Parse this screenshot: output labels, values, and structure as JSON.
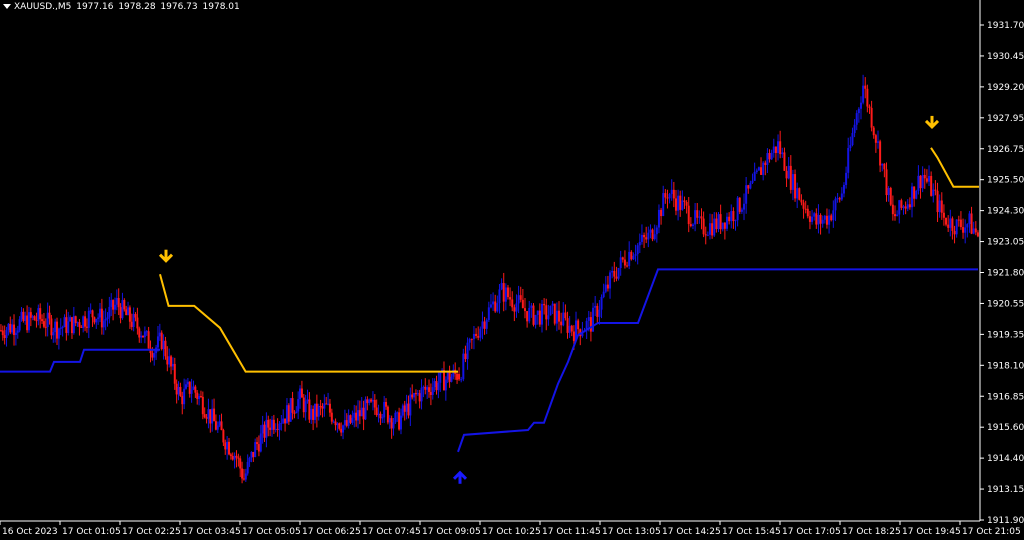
{
  "header": {
    "symbol": "XAUUSD.,M5",
    "open": "1977.16",
    "high": "1978.28",
    "low": "1976.73",
    "close": "1978.01"
  },
  "colors": {
    "background": "#000000",
    "bull_candle": "#1414e6",
    "bear_candle": "#ff1a1a",
    "upper_line": "#ffc000",
    "lower_line": "#1414e6",
    "sell_arrow": "#ffc000",
    "buy_arrow": "#1a1aff",
    "axis": "#ffffff"
  },
  "chart_data": {
    "type": "candlestick",
    "title": "",
    "ylim": [
      1911.6,
      1932.4
    ],
    "y_ticks": [
      "1931.70",
      "1930.45",
      "1929.20",
      "1927.95",
      "1926.75",
      "1925.50",
      "1924.30",
      "1923.05",
      "1921.80",
      "1920.55",
      "1919.35",
      "1918.10",
      "1916.85",
      "1915.60",
      "1914.40",
      "1913.15",
      "1911.90"
    ],
    "x_ticks": [
      "16 Oct 2023",
      "17 Oct 01:05",
      "17 Oct 02:25",
      "17 Oct 03:45",
      "17 Oct 05:05",
      "17 Oct 06:25",
      "17 Oct 07:45",
      "17 Oct 09:05",
      "17 Oct 10:25",
      "17 Oct 11:45",
      "17 Oct 13:05",
      "17 Oct 14:25",
      "17 Oct 15:45",
      "17 Oct 17:05",
      "17 Oct 18:25",
      "17 Oct 19:45",
      "17 Oct 21:05"
    ],
    "candle_count": 245,
    "anchors": [
      [
        0,
        1919.4
      ],
      [
        10,
        1919.7
      ],
      [
        20,
        1919.9
      ],
      [
        30,
        1919.5
      ],
      [
        40,
        1919.7
      ],
      [
        50,
        1920.1
      ],
      [
        55,
        1919.8
      ],
      [
        62,
        1920.5
      ],
      [
        67,
        1920.0
      ],
      [
        75,
        1919.4
      ],
      [
        78,
        1919.0
      ],
      [
        82,
        1918.6
      ],
      [
        86,
        1919.0
      ],
      [
        89,
        1918.3
      ],
      [
        92,
        1917.6
      ],
      [
        96,
        1916.6
      ],
      [
        102,
        1917.1
      ],
      [
        108,
        1916.4
      ],
      [
        114,
        1915.6
      ],
      [
        120,
        1914.9
      ],
      [
        126,
        1914.2
      ],
      [
        130,
        1913.3
      ],
      [
        136,
        1914.6
      ],
      [
        144,
        1915.6
      ],
      [
        152,
        1915.9
      ],
      [
        160,
        1916.6
      ],
      [
        166,
        1915.9
      ],
      [
        174,
        1916.2
      ],
      [
        184,
        1915.4
      ],
      [
        194,
        1916.1
      ],
      [
        202,
        1916.3
      ],
      [
        212,
        1915.6
      ],
      [
        222,
        1916.7
      ],
      [
        232,
        1917.2
      ],
      [
        244,
        1917.6
      ]
    ],
    "anchors_b": [
      [
        0,
        1917.6
      ],
      [
        8,
        1919.3
      ],
      [
        14,
        1920.2
      ],
      [
        20,
        1921.0
      ],
      [
        26,
        1920.6
      ],
      [
        34,
        1920.0
      ],
      [
        44,
        1920.1
      ],
      [
        54,
        1919.4
      ],
      [
        62,
        1919.7
      ],
      [
        72,
        1921.6
      ],
      [
        80,
        1922.6
      ],
      [
        90,
        1923.3
      ],
      [
        98,
        1925.1
      ],
      [
        106,
        1924.4
      ],
      [
        114,
        1923.6
      ],
      [
        122,
        1923.8
      ],
      [
        130,
        1924.3
      ],
      [
        138,
        1925.3
      ],
      [
        144,
        1926.4
      ],
      [
        150,
        1927.0
      ],
      [
        156,
        1925.6
      ],
      [
        162,
        1924.6
      ],
      [
        168,
        1923.8
      ],
      [
        174,
        1924.1
      ],
      [
        180,
        1925.0
      ],
      [
        186,
        1927.9
      ],
      [
        190,
        1929.5
      ],
      [
        194,
        1928.1
      ],
      [
        198,
        1926.6
      ],
      [
        204,
        1924.0
      ],
      [
        210,
        1924.6
      ],
      [
        214,
        1925.2
      ],
      [
        218,
        1925.8
      ],
      [
        222,
        1925.2
      ],
      [
        228,
        1924.0
      ],
      [
        234,
        1923.7
      ],
      [
        240,
        1923.8
      ],
      [
        244,
        1923.3
      ]
    ],
    "upper_line": [
      [
        0,
        1921.7
      ],
      [
        5,
        1920.4
      ],
      [
        20,
        1920.4
      ],
      [
        35,
        1919.5
      ],
      [
        50,
        1917.7
      ],
      [
        174,
        1917.7
      ]
    ],
    "upper_line_2": [
      [
        0,
        1926.9
      ],
      [
        4,
        1926.5
      ],
      [
        14,
        1925.3
      ],
      [
        30,
        1925.3
      ]
    ],
    "lower_line": [
      [
        0,
        1917.7
      ],
      [
        50,
        1917.7
      ],
      [
        54,
        1918.1
      ],
      [
        80,
        1918.1
      ],
      [
        84,
        1918.6
      ],
      [
        160,
        1918.6
      ]
    ],
    "lower_line_2": [
      [
        0,
        1914.4
      ],
      [
        3,
        1915.1
      ],
      [
        35,
        1915.3
      ],
      [
        38,
        1915.6
      ],
      [
        43,
        1915.6
      ],
      [
        50,
        1917.2
      ],
      [
        55,
        1918.1
      ],
      [
        60,
        1919.2
      ],
      [
        70,
        1919.7
      ],
      [
        90,
        1919.7
      ],
      [
        100,
        1921.9
      ],
      [
        260,
        1921.9
      ]
    ],
    "signals": [
      {
        "type": "sell",
        "label": "down-arrow",
        "price": 1922.3,
        "time_label": "17 Oct 02:25"
      },
      {
        "type": "buy",
        "label": "up-arrow",
        "price": 1913.5,
        "time_label": "17 Oct 09:05"
      },
      {
        "type": "sell",
        "label": "down-arrow",
        "price": 1927.8,
        "time_label": "17 Oct 19:45"
      }
    ]
  }
}
